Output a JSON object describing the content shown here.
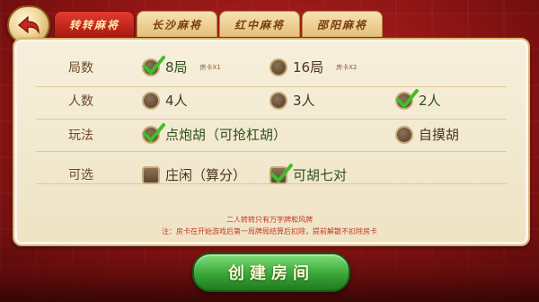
{
  "tabs": [
    {
      "label": "转转麻将",
      "active": true
    },
    {
      "label": "长沙麻将",
      "active": false
    },
    {
      "label": "红中麻将",
      "active": false
    },
    {
      "label": "邵阳麻将",
      "active": false
    }
  ],
  "rows": {
    "rounds": {
      "label": "局数",
      "options": [
        {
          "label": "8局",
          "note": "房卡X1",
          "checked": true
        },
        {
          "label": "16局",
          "note": "房卡X2",
          "checked": false
        }
      ]
    },
    "players": {
      "label": "人数",
      "options": [
        {
          "label": "4人",
          "checked": false
        },
        {
          "label": "3人",
          "checked": false
        },
        {
          "label": "2人",
          "checked": true
        }
      ]
    },
    "rules": {
      "label": "玩法",
      "options": [
        {
          "label": "点炮胡（可抢杠胡）",
          "checked": true
        },
        {
          "label": "自摸胡",
          "checked": false
        }
      ]
    },
    "optional": {
      "label": "可选",
      "options": [
        {
          "label": "庄闲（算分）",
          "checked": false
        },
        {
          "label": "可胡七对",
          "checked": true
        }
      ]
    }
  },
  "notes": {
    "line1": "二人转转只有万字牌和风牌",
    "line2": "注：房卡在开始游戏后第一局牌局结算后扣除，提前解散不扣除房卡"
  },
  "create_button": "创建房间",
  "colors": {
    "check": "#3fbf2a",
    "accent": "#a81a12"
  }
}
